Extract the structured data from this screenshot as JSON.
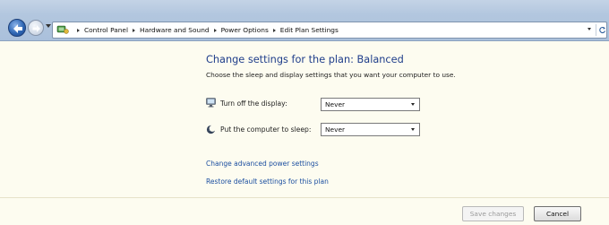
{
  "address_bar": {
    "breadcrumbs": [
      "Control Panel",
      "Hardware and Sound",
      "Power Options",
      "Edit Plan Settings"
    ]
  },
  "main": {
    "title": "Change settings for the plan: Balanced",
    "subtitle": "Choose the sleep and display settings that you want your computer to use.",
    "settings": [
      {
        "label": "Turn off the display:",
        "value": "Never",
        "icon": "monitor-icon"
      },
      {
        "label": "Put the computer to sleep:",
        "value": "Never",
        "icon": "moon-icon"
      }
    ],
    "links": {
      "advanced": "Change advanced power settings",
      "restore": "Restore default settings for this plan"
    }
  },
  "buttons": {
    "save": "Save changes",
    "cancel": "Cancel",
    "save_enabled": false
  },
  "colors": {
    "title": "#1e3d8a",
    "link": "#1c4fa0",
    "background": "#fdfcf0"
  }
}
